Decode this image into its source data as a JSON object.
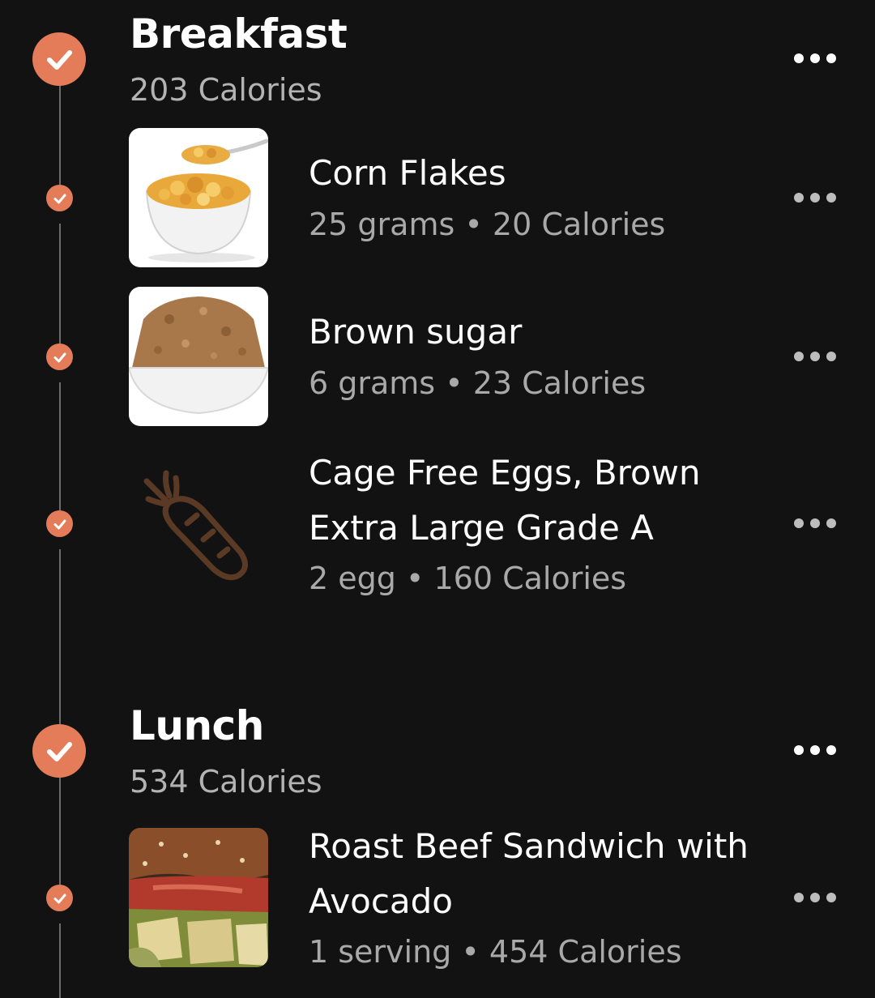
{
  "colors": {
    "background": "#121212",
    "accent": "#e47c59",
    "secondary_text": "#a9a9a9"
  },
  "meals": [
    {
      "title": "Breakfast",
      "calories": "203 Calories",
      "items": [
        {
          "name": "Corn Flakes",
          "amount": "25 grams",
          "calories": "20 Calories",
          "image": "corn-flakes-bowl"
        },
        {
          "name": "Brown sugar",
          "amount": "6 grams",
          "calories": "23 Calories",
          "image": "brown-sugar-bowl"
        },
        {
          "name": "Cage Free Eggs, Brown Extra Large Grade A",
          "amount": "2 egg",
          "calories": "160 Calories",
          "image": "carrot-placeholder-icon"
        }
      ]
    },
    {
      "title": "Lunch",
      "calories": "534 Calories",
      "items": [
        {
          "name": "Roast Beef Sandwich with Avocado",
          "amount": "1 serving",
          "calories": "454 Calories",
          "image": "roast-beef-sandwich"
        }
      ]
    }
  ],
  "separator": "•"
}
